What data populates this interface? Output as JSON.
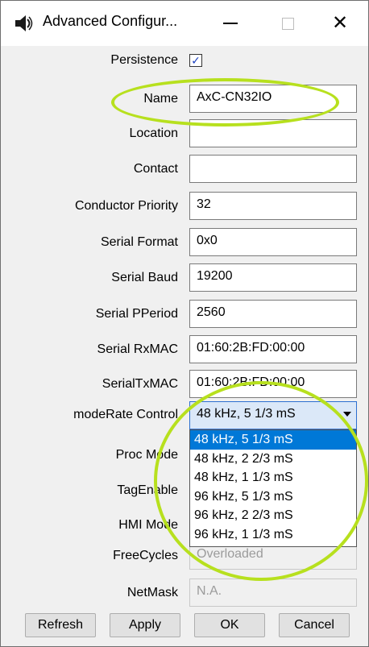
{
  "window": {
    "title": "Advanced Configur...",
    "icons": [
      "speaker-icon",
      "minimize-icon",
      "maximize-icon",
      "close-icon"
    ]
  },
  "form": {
    "persistence": {
      "label": "Persistence",
      "checked": true,
      "check_glyph": "✓"
    },
    "name": {
      "label": "Name",
      "value": "AxC-CN32IO"
    },
    "location": {
      "label": "Location",
      "value": ""
    },
    "contact": {
      "label": "Contact",
      "value": ""
    },
    "conductor_priority": {
      "label": "Conductor Priority",
      "value": "32"
    },
    "serial_format": {
      "label": "Serial Format",
      "value": "0x0"
    },
    "serial_baud": {
      "label": "Serial Baud",
      "value": "19200"
    },
    "serial_pperiod": {
      "label": "Serial PPeriod",
      "value": "2560"
    },
    "serial_rxmac": {
      "label": "Serial RxMAC",
      "value": "01:60:2B:FD:00:00"
    },
    "serial_txmac": {
      "label": "SerialTxMAC",
      "value": "01:60:2B:FD:00:00"
    },
    "moderate_control": {
      "label": "modeRate Control",
      "selected": "48 kHz, 5 1/3 mS",
      "options": [
        "48 kHz, 5 1/3 mS",
        "48 kHz, 2 2/3 mS",
        "48 kHz, 1 1/3 mS",
        "96 kHz, 5 1/3 mS",
        "96 kHz, 2 2/3 mS",
        "96 kHz, 1 1/3 mS"
      ]
    },
    "proc_mode": {
      "label": "Proc Mode"
    },
    "tag_enable": {
      "label": "TagEnable"
    },
    "hmi_mode": {
      "label": "HMI Mode"
    },
    "free_cycles": {
      "label": "FreeCycles",
      "value": "Overloaded"
    },
    "netmask": {
      "label": "NetMask",
      "value": "N.A."
    }
  },
  "buttons": {
    "refresh": "Refresh",
    "apply": "Apply",
    "ok": "OK",
    "cancel": "Cancel"
  },
  "colors": {
    "highlight_ellipse": "#b7e01e",
    "selection": "#0078d7"
  }
}
